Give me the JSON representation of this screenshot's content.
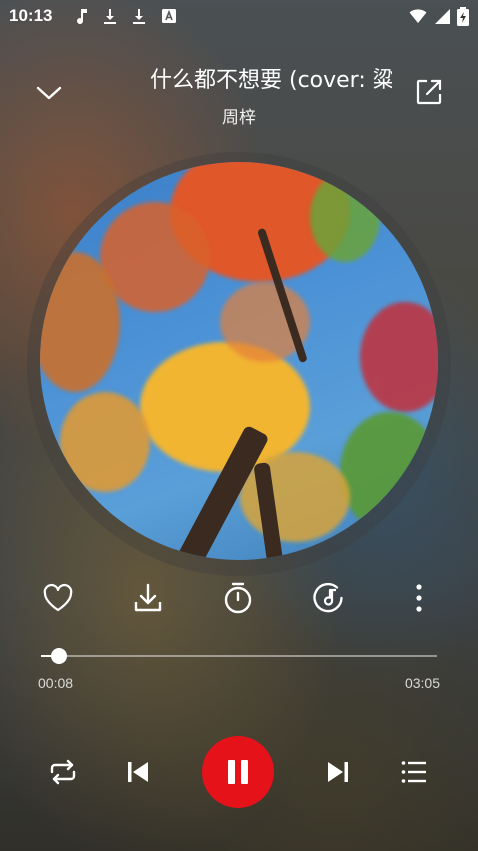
{
  "status_bar": {
    "time": "10:13",
    "icons": [
      "music-note-icon",
      "download-icon",
      "download-icon",
      "translate-icon",
      "wifi-icon",
      "signal-icon",
      "battery-charging-icon"
    ]
  },
  "header": {
    "title": "什么都不想要 (cover: 粱",
    "artist": "周梓"
  },
  "actions": [
    "heart-icon",
    "download-icon",
    "timer-icon",
    "music-disc-icon",
    "more-vertical-icon"
  ],
  "progress": {
    "elapsed": "00:08",
    "total": "03:05",
    "fraction": 0.045
  },
  "controls": [
    "repeat-icon",
    "previous-icon",
    "pause-icon",
    "next-icon",
    "playlist-icon"
  ],
  "colors": {
    "accent": "#e5121a"
  }
}
